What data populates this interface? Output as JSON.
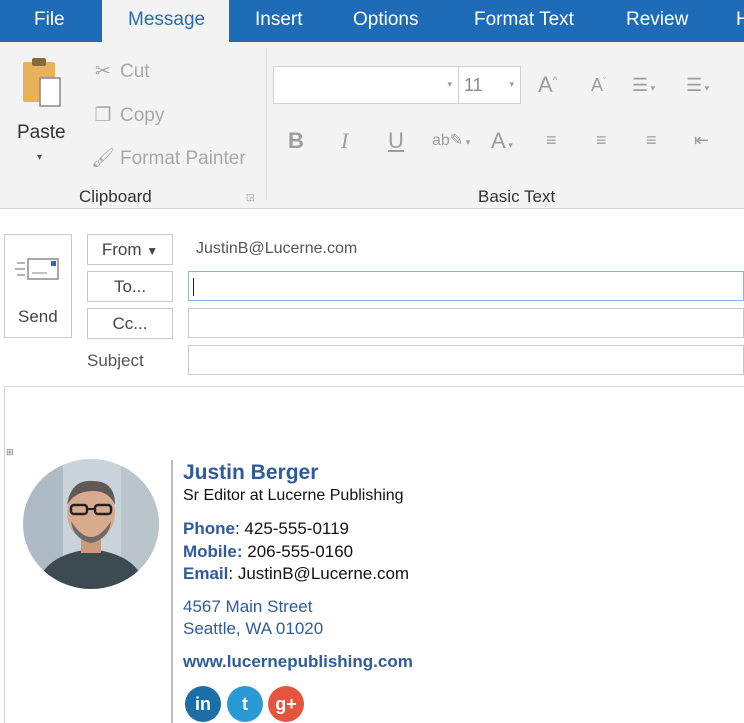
{
  "ribbon": {
    "tabs": [
      {
        "label": "File",
        "active": false
      },
      {
        "label": "Message",
        "active": true
      },
      {
        "label": "Insert",
        "active": false
      },
      {
        "label": "Options",
        "active": false
      },
      {
        "label": "Format Text",
        "active": false
      },
      {
        "label": "Review",
        "active": false
      },
      {
        "label": "H",
        "active": false
      }
    ],
    "clipboard": {
      "paste_label": "Paste",
      "cut_label": "Cut",
      "copy_label": "Copy",
      "format_painter_label": "Format Painter",
      "group_label": "Clipboard"
    },
    "basic_text": {
      "font_name": "",
      "font_size": "11",
      "group_label": "Basic Text"
    }
  },
  "compose": {
    "send_label": "Send",
    "from_label": "From",
    "from_value": "JustinB@Lucerne.com",
    "to_label": "To...",
    "to_value": "",
    "cc_label": "Cc...",
    "cc_value": "",
    "subject_label": "Subject",
    "subject_value": ""
  },
  "signature": {
    "name": "Justin Berger",
    "title": "Sr Editor at Lucerne Publishing",
    "phone_label": "Phone",
    "phone": "425-555-0119",
    "mobile_label": "Mobile:",
    "mobile": "206-555-0160",
    "email_label": "Email",
    "email": "JustinB@Lucerne.com",
    "address_line1": "4567 Main Street",
    "address_line2": "Seattle, WA 01020",
    "website": "www.lucernepublishing.com",
    "social": [
      {
        "icon": "linkedin-icon",
        "glyph": "in",
        "color": "#1b6ea6"
      },
      {
        "icon": "twitter-icon",
        "glyph": "t",
        "color": "#2a9ad6"
      },
      {
        "icon": "google-plus-icon",
        "glyph": "g+",
        "color": "#e4553d"
      }
    ]
  },
  "colors": {
    "ribbon_tab_bar": "#1e6bb8",
    "signature_accent": "#2f5b9c"
  }
}
